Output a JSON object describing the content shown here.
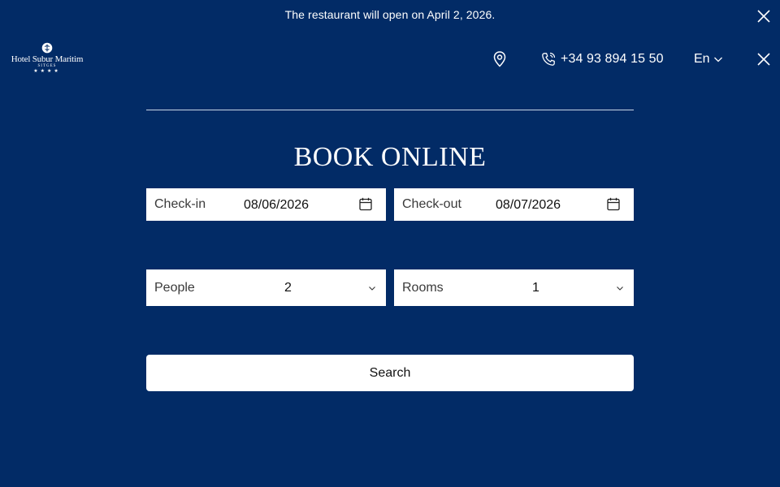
{
  "announcement": {
    "text": "The restaurant will open on April 2, 2026."
  },
  "header": {
    "logo": {
      "name": "Hotel Subur Maritim",
      "city": "SITGES",
      "stars": "★★★★"
    },
    "phone": "+34 93 894 15 50",
    "language": "En",
    "icons": {
      "location": "map-pin-icon",
      "phone": "phone-icon",
      "language_caret": "chevron-down-icon",
      "close": "close-icon"
    }
  },
  "booking": {
    "title": "BOOK ONLINE",
    "checkin": {
      "label": "Check-in",
      "value": "08/06/2026"
    },
    "checkout": {
      "label": "Check-out",
      "value": "08/07/2026"
    },
    "people": {
      "label": "People",
      "value": "2"
    },
    "rooms": {
      "label": "Rooms",
      "value": "1"
    },
    "search_label": "Search"
  },
  "colors": {
    "background": "#022b66",
    "field_background": "#ffffff",
    "text_light": "#ffffff"
  }
}
